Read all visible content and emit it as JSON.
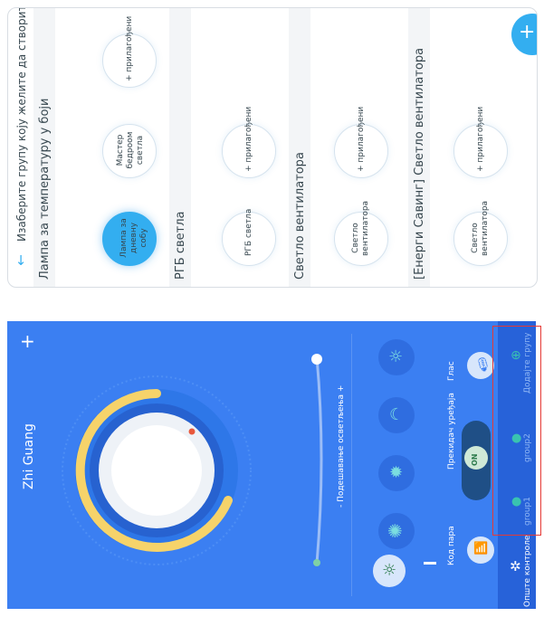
{
  "group_panel": {
    "title": "Изаберите групу коју желите да створите",
    "back_icon": "arrow-down-icon",
    "add_icon": "plus-icon",
    "sections": [
      {
        "label": "Лампа за температуру у боји",
        "items": [
          "Лампа за дневну собу",
          "Мастер бедроом светла",
          "+ прилагођени"
        ]
      },
      {
        "label": "РГБ светла",
        "items": [
          "РГБ светла",
          "+ прилагођени"
        ]
      },
      {
        "label": "Светло вентилатора",
        "items": [
          "Светло вентилатора",
          "+ прилагођени"
        ]
      },
      {
        "label": "[Енерги Савинг] Светло вентилатора",
        "items": [
          "Светло вентилатора",
          "+ прилагођени"
        ]
      }
    ]
  },
  "control_panel": {
    "title": "Zhi Guang",
    "add_icon": "plus-icon",
    "brightness_label": "- Подешавање осветљења +",
    "scenes": [
      "sun-icon",
      "bug-icon",
      "moon-icon",
      "sun-outline-icon"
    ],
    "bottom_labels": {
      "code": "Код пара",
      "switch": "Прекидач уређаја",
      "voice": "Глас"
    },
    "switch_state": "ON",
    "colors": {
      "panel": "#3b7ff2",
      "accent": "#33aef0",
      "ring": "#f6d36a"
    },
    "nav": [
      {
        "label": "Опште контроле",
        "icon": "gear-icon"
      },
      {
        "label": "group1",
        "icon": "bulb-icon"
      },
      {
        "label": "group2",
        "icon": "bulb-icon"
      },
      {
        "label": "Додајте групу",
        "icon": "add-circle-icon"
      }
    ]
  }
}
